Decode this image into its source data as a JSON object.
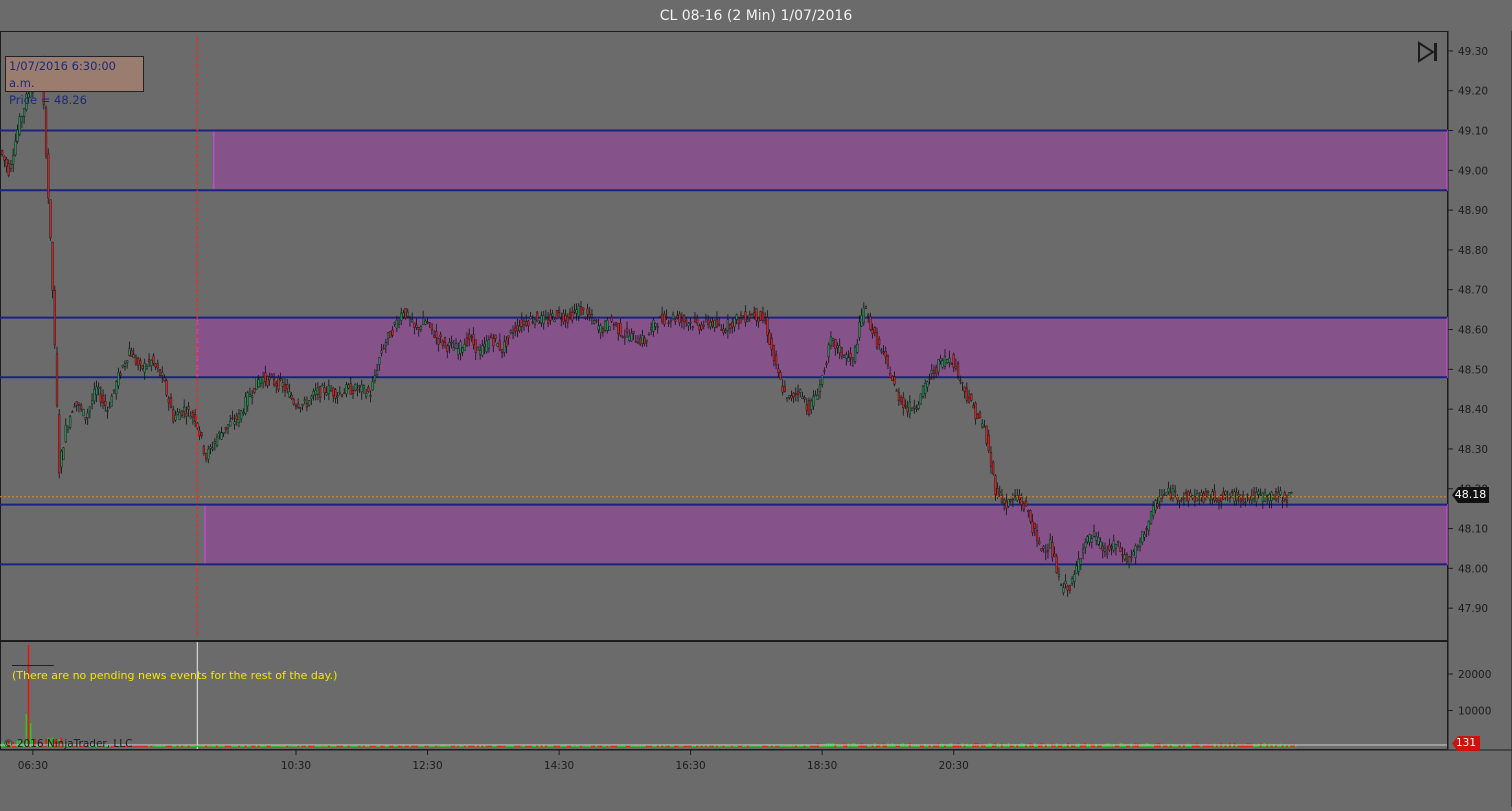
{
  "window": {
    "title": "CL 08-16 (2 Min)  1/07/2016"
  },
  "tooltip": {
    "line1": "1/07/2016 6:30:00 a.m.",
    "line2": "Price = 48.26"
  },
  "news": {
    "message": "(There are no pending news events for the rest of the day.)"
  },
  "footer": {
    "copyright": "© 2016 NinjaTrader, LLC"
  },
  "badges": {
    "last_price": "48.18",
    "last_volume": "131"
  },
  "colors": {
    "background": "#6b6b6b",
    "zone_fill": "#8a4f8e",
    "zone_border": "#b84dcc",
    "level_line": "#1a237e",
    "current_price_line": "#e08a2a",
    "session_marker": "#ff2222",
    "candle_up": "#2e8b57",
    "candle_down": "#c62828",
    "volume_up": "#22cc22",
    "volume_down": "#ee1111"
  },
  "icons": {
    "end_of_data": "skip-to-end-icon"
  },
  "chart_data": [
    {
      "type": "candlestick",
      "ylim": [
        47.82,
        49.35
      ],
      "y_ticks": [
        "49.30",
        "49.20",
        "49.10",
        "49.00",
        "48.90",
        "48.80",
        "48.70",
        "48.60",
        "48.50",
        "48.40",
        "48.30",
        "48.20",
        "48.10",
        "48.00",
        "47.90"
      ],
      "x_ticks": [
        "06:30",
        "10:30",
        "12:30",
        "14:30",
        "16:30",
        "18:30",
        "20:30"
      ],
      "x_range_minutes": [
        360,
        1680
      ],
      "current_price": 48.18,
      "session_marker_minute": 540,
      "horizontal_levels": [
        49.1,
        48.95,
        48.63,
        48.48,
        48.16,
        48.01
      ],
      "zones": [
        {
          "from_minute": 555,
          "to_minute": 1680,
          "low": 48.95,
          "high": 49.1
        },
        {
          "from_minute": 540,
          "to_minute": 1680,
          "low": 48.48,
          "high": 48.63
        },
        {
          "from_minute": 547,
          "to_minute": 1680,
          "low": 48.01,
          "high": 48.16
        }
      ],
      "path_minutes": [
        362,
        370,
        378,
        386,
        394,
        400,
        404,
        410,
        416,
        422,
        430,
        440,
        450,
        460,
        470,
        480,
        490,
        500,
        510,
        520,
        530,
        540,
        550,
        560,
        570,
        580,
        590,
        600,
        610,
        620,
        630,
        640,
        650,
        660,
        670,
        680,
        690,
        700,
        710,
        720,
        730,
        740,
        750,
        760,
        770,
        780,
        790,
        800,
        810,
        820,
        830,
        840,
        850,
        860,
        870,
        880,
        890,
        900,
        910,
        920,
        930,
        940,
        950,
        960,
        970,
        980,
        990,
        1000,
        1010,
        1020,
        1030,
        1040,
        1050,
        1060,
        1070,
        1080,
        1090,
        1100,
        1110,
        1120,
        1130,
        1140,
        1150,
        1160,
        1170,
        1180,
        1190,
        1200,
        1210,
        1220,
        1230,
        1240,
        1250,
        1260,
        1270,
        1280,
        1290,
        1300,
        1310,
        1320,
        1330,
        1340,
        1350,
        1360,
        1370,
        1380,
        1390,
        1400,
        1410,
        1420,
        1430,
        1440,
        1450,
        1460,
        1470,
        1480,
        1490,
        1500,
        1510,
        1520,
        1530,
        1540,
        1550
      ],
      "path_prices": [
        49.05,
        49.0,
        49.1,
        49.18,
        49.24,
        49.26,
        49.05,
        48.7,
        48.25,
        48.35,
        48.42,
        48.38,
        48.45,
        48.4,
        48.48,
        48.55,
        48.5,
        48.52,
        48.48,
        48.38,
        48.4,
        48.38,
        48.28,
        48.33,
        48.36,
        48.38,
        48.44,
        48.48,
        48.47,
        48.46,
        48.42,
        48.41,
        48.44,
        48.45,
        48.44,
        48.45,
        48.45,
        48.44,
        48.55,
        48.6,
        48.65,
        48.6,
        48.62,
        48.58,
        48.56,
        48.55,
        48.58,
        48.54,
        48.58,
        48.55,
        48.6,
        48.62,
        48.63,
        48.62,
        48.64,
        48.63,
        48.65,
        48.63,
        48.6,
        48.62,
        48.59,
        48.58,
        48.57,
        48.62,
        48.63,
        48.63,
        48.62,
        48.61,
        48.62,
        48.6,
        48.62,
        48.63,
        48.64,
        48.62,
        48.5,
        48.42,
        48.45,
        48.4,
        48.46,
        48.57,
        48.54,
        48.52,
        48.66,
        48.58,
        48.52,
        48.44,
        48.4,
        48.42,
        48.48,
        48.52,
        48.53,
        48.46,
        48.4,
        48.35,
        48.2,
        48.16,
        48.18,
        48.14,
        48.05,
        48.06,
        47.95,
        47.96,
        48.06,
        48.08,
        48.04,
        48.06,
        48.02,
        48.05,
        48.12,
        48.18,
        48.19,
        48.18,
        48.18,
        48.18,
        48.18,
        48.18,
        48.18,
        48.18,
        48.18,
        48.18,
        48.18,
        48.18
      ]
    },
    {
      "type": "bar",
      "title": "",
      "y_ticks": [
        "20000",
        "10000"
      ],
      "ylim": [
        0,
        28500
      ],
      "spike_minutes": [
        384,
        386,
        388
      ],
      "spike_values": [
        9000,
        28000,
        6500
      ],
      "base_volume_activity": "low"
    }
  ]
}
